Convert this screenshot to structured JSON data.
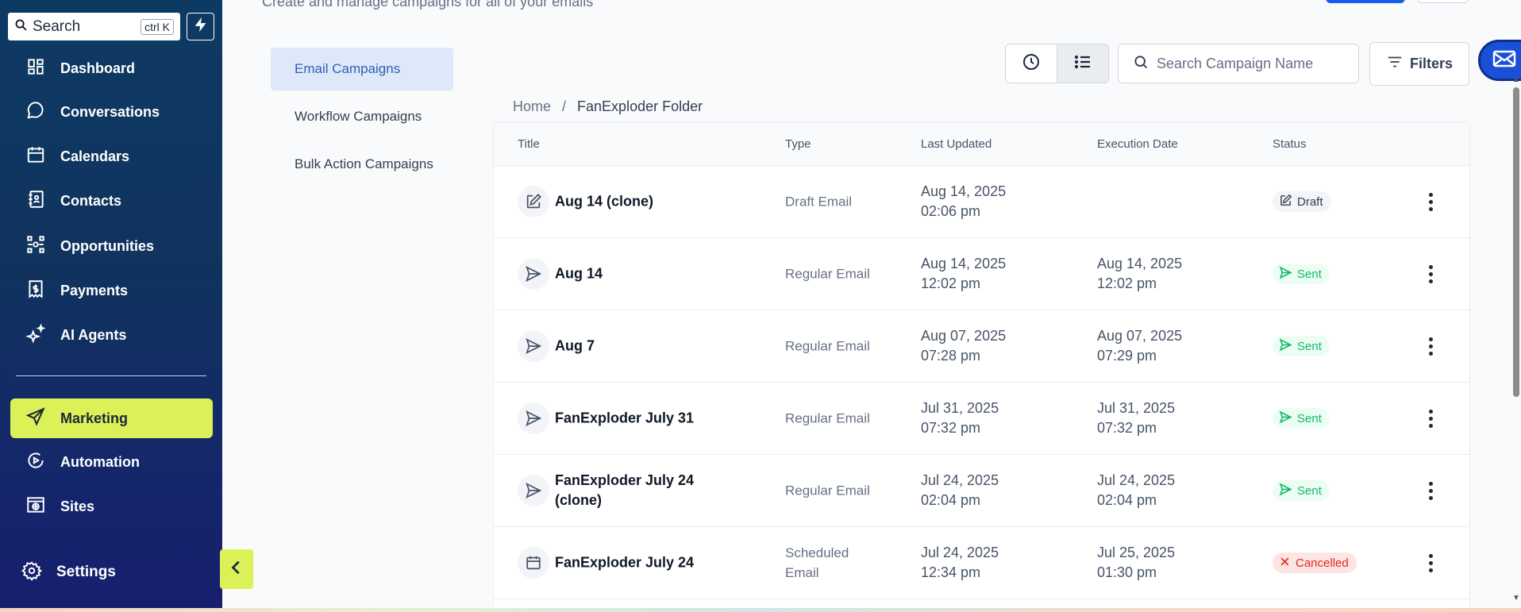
{
  "search": {
    "label": "Search",
    "shortcut": "ctrl K"
  },
  "sidebar": {
    "items": [
      {
        "label": "Dashboard",
        "icon": "dashboard-icon"
      },
      {
        "label": "Conversations",
        "icon": "chat-bubble-icon"
      },
      {
        "label": "Calendars",
        "icon": "calendar-icon"
      },
      {
        "label": "Contacts",
        "icon": "contacts-book-icon"
      },
      {
        "label": "Opportunities",
        "icon": "pipeline-icon"
      },
      {
        "label": "Payments",
        "icon": "invoice-icon"
      },
      {
        "label": "AI Agents",
        "icon": "sparkles-icon"
      },
      {
        "label": "Marketing",
        "icon": "send-icon"
      },
      {
        "label": "Automation",
        "icon": "automation-icon"
      },
      {
        "label": "Sites",
        "icon": "sites-icon"
      }
    ],
    "settings": "Settings",
    "active_color": "#dcf157"
  },
  "header": {
    "subtitle": "Create and manage campaigns for all of your emails"
  },
  "leftnav": [
    {
      "label": "Email Campaigns"
    },
    {
      "label": "Workflow Campaigns"
    },
    {
      "label": "Bulk Action Campaigns"
    }
  ],
  "toolbar": {
    "search_placeholder": "Search Campaign Name",
    "filters": "Filters"
  },
  "breadcrumb": {
    "home": "Home",
    "sep": "/",
    "current": "FanExploder Folder"
  },
  "table": {
    "columns": [
      "Title",
      "Type",
      "Last Updated",
      "Execution Date",
      "Status"
    ],
    "rows": [
      {
        "title": "Aug 14 (clone)",
        "type": "Draft Email",
        "updated": "Aug 14, 2025\n02:06 pm",
        "executed": "",
        "status": "Draft",
        "icon": "edit-icon"
      },
      {
        "title": "Aug 14",
        "type": "Regular Email",
        "updated": "Aug 14, 2025\n12:02 pm",
        "executed": "Aug 14, 2025\n12:02 pm",
        "status": "Sent",
        "icon": "send-icon"
      },
      {
        "title": "Aug 7",
        "type": "Regular Email",
        "updated": "Aug 07, 2025\n07:28 pm",
        "executed": "Aug 07, 2025\n07:29 pm",
        "status": "Sent",
        "icon": "send-icon"
      },
      {
        "title": "FanExploder July 31",
        "type": "Regular Email",
        "updated": "Jul 31, 2025\n07:32 pm",
        "executed": "Jul 31, 2025\n07:32 pm",
        "status": "Sent",
        "icon": "send-icon"
      },
      {
        "title": "FanExploder July 24 (clone)",
        "type": "Regular Email",
        "updated": "Jul 24, 2025\n02:04 pm",
        "executed": "Jul 24, 2025\n02:04 pm",
        "status": "Sent",
        "icon": "send-icon"
      },
      {
        "title": "FanExploder July 24",
        "type": "Scheduled Email",
        "updated": "Jul 24, 2025\n12:34 pm",
        "executed": "Jul 25, 2025\n01:30 pm",
        "status": "Cancelled",
        "icon": "calendar-icon"
      }
    ]
  }
}
